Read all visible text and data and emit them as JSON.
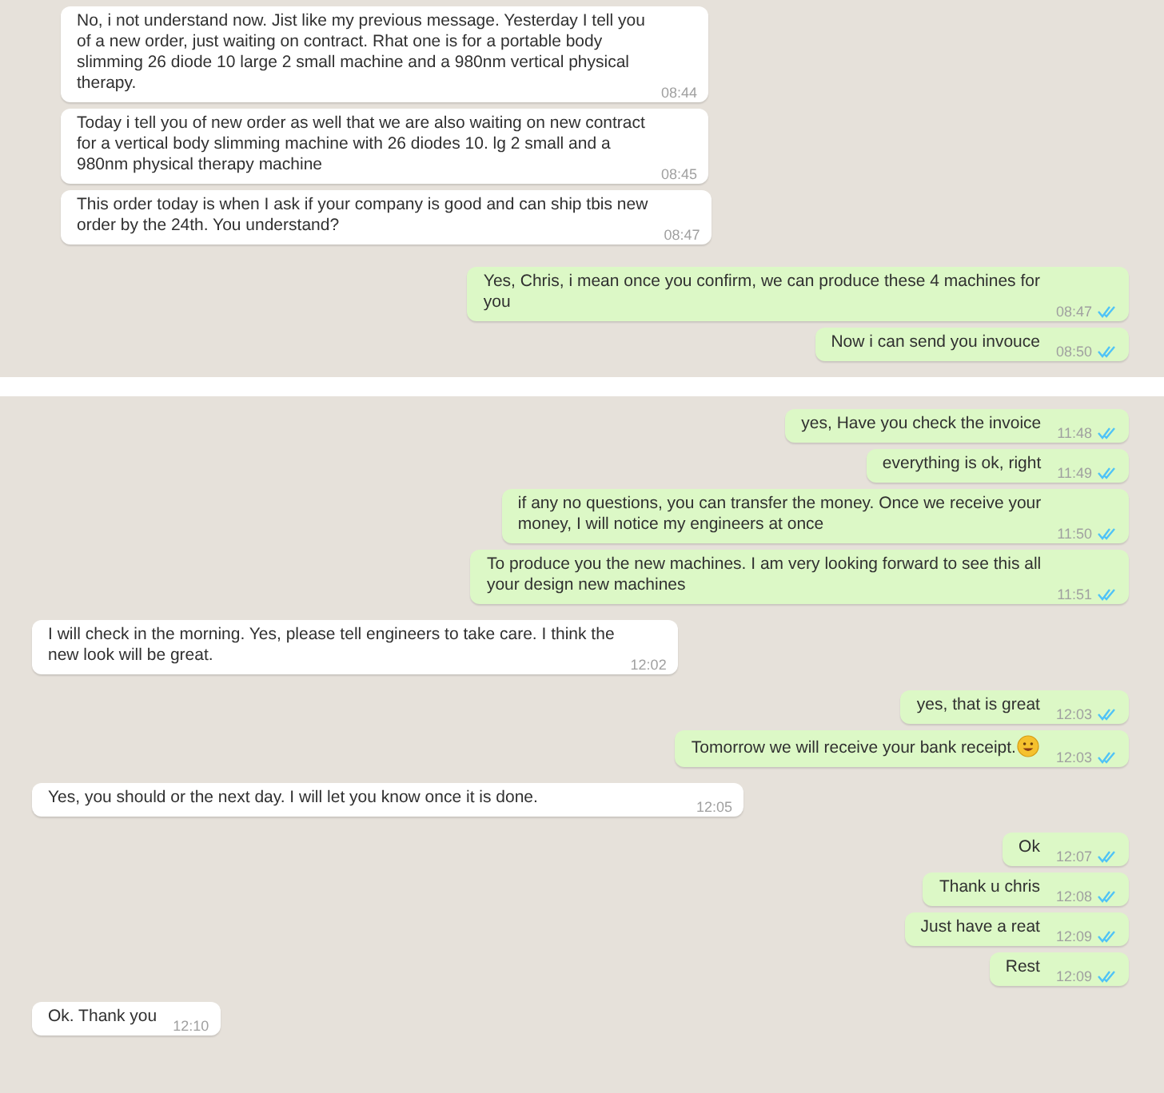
{
  "panels": [
    {
      "messages": [
        {
          "kind": "incoming",
          "text": "No, i not understand now.  Jist like my previous message.  Yesterday I tell you\nof a new order, just waiting on contract.  Rhat one is for a portable body\nslimming 26 diode 10 large 2 small machine and a 980nm vertical physical\ntherapy.",
          "time": "08:44"
        },
        {
          "kind": "incoming",
          "text": "Today i tell you of new order as well that we are also waiting on new contract\nfor a vertical body slimming machine with 26 diodes 10. lg 2 small and a\n980nm physical therapy machine",
          "time": "08:45"
        },
        {
          "kind": "incoming",
          "text": "This order today is when I ask if your company is good and can ship tbis new\norder by the 24th.  You understand?",
          "time": "08:47"
        },
        {
          "kind": "outgoing",
          "text": "Yes, Chris, i mean once you confirm, we can produce these 4 machines for\nyou",
          "time": "08:47",
          "read": true
        },
        {
          "kind": "outgoing",
          "text": "Now i can send you invouce",
          "time": "08:50",
          "read": true
        }
      ]
    },
    {
      "messages": [
        {
          "kind": "outgoing",
          "text": "yes, Have you check the invoice",
          "time": "11:48",
          "read": true
        },
        {
          "kind": "outgoing",
          "text": "everything is ok, right",
          "time": "11:49",
          "read": true
        },
        {
          "kind": "outgoing",
          "text": "if any no questions, you can transfer the money. Once we receive your\nmoney, I will notice my engineers at once",
          "time": "11:50",
          "read": true
        },
        {
          "kind": "outgoing",
          "text": "To produce you the new machines. I am very looking forward to see this all\nyour design new machines",
          "time": "11:51",
          "read": true
        },
        {
          "kind": "incoming",
          "text": "I will check in the morning.  Yes, please tell engineers to take care.  I think the\nnew look will be great.",
          "time": "12:02"
        },
        {
          "kind": "outgoing",
          "text": "yes, that is great",
          "time": "12:03",
          "read": true
        },
        {
          "kind": "outgoing",
          "text": "Tomorrow we will receive your bank receipt.",
          "time": "12:03",
          "read": true,
          "emoji": true
        },
        {
          "kind": "incoming",
          "text": "Yes, you should or the next day.  I will let you know once it is done.",
          "time": "12:05",
          "wide": true
        },
        {
          "kind": "outgoing",
          "text": "Ok",
          "time": "12:07",
          "read": true
        },
        {
          "kind": "outgoing",
          "text": "Thank u chris",
          "time": "12:08",
          "read": true
        },
        {
          "kind": "outgoing",
          "text": "Just have a reat",
          "time": "12:09",
          "read": true
        },
        {
          "kind": "outgoing",
          "text": "Rest",
          "time": "12:09",
          "read": true
        },
        {
          "kind": "incoming",
          "text": "Ok. Thank you",
          "time": "12:10"
        }
      ]
    }
  ]
}
